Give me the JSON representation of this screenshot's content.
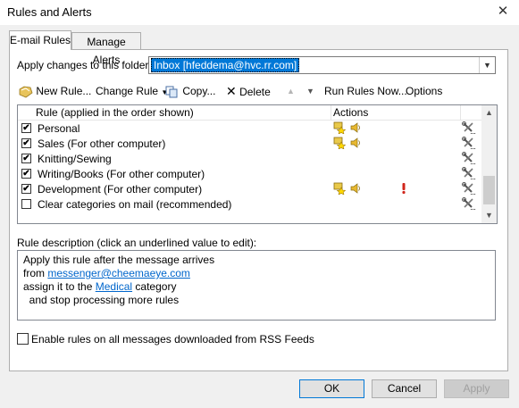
{
  "window": {
    "title": "Rules and Alerts",
    "close_glyph": "✕"
  },
  "tabs": [
    {
      "label": "E-mail Rules"
    },
    {
      "label": "Manage Alerts"
    }
  ],
  "folder": {
    "label": "Apply changes to this folder:",
    "value": "Inbox [hfeddema@hvc.rr.com]"
  },
  "toolbar": {
    "new_rule": "New Rule...",
    "change_rule": "Change Rule",
    "copy": "Copy...",
    "delete": "Delete",
    "run_rules": "Run Rules Now...",
    "options": "Options"
  },
  "rules_list": {
    "columns": {
      "rule": "Rule (applied in the order shown)",
      "actions": "Actions"
    },
    "rows": [
      {
        "name": "Personal",
        "checked": true,
        "icons": [
          "category-icon",
          "sound-icon"
        ]
      },
      {
        "name": "Sales  (For other computer)",
        "checked": true,
        "icons": [
          "category-icon",
          "sound-icon"
        ]
      },
      {
        "name": "Knitting/Sewing",
        "checked": true,
        "icons": []
      },
      {
        "name": "Writing/Books  (For other computer)",
        "checked": true,
        "icons": []
      },
      {
        "name": "Development  (For other computer)",
        "checked": true,
        "icons": [
          "category-icon",
          "sound-icon",
          "importance-icon"
        ]
      },
      {
        "name": "Clear categories on mail (recommended)",
        "checked": false,
        "icons": []
      }
    ],
    "checkmark": "✔"
  },
  "description": {
    "label": "Rule description (click an underlined value to edit):",
    "line1": "Apply this rule after the message arrives",
    "line2_prefix": "from ",
    "line2_link": "messenger@cheemaeye.com",
    "line3_prefix": "assign it to the ",
    "line3_link": "Medical",
    "line3_suffix": " category",
    "line4": "  and stop processing more rules"
  },
  "rss": {
    "label": "Enable rules on all messages downloaded from RSS Feeds",
    "checked": false
  },
  "buttons": {
    "ok": "OK",
    "cancel": "Cancel",
    "apply": "Apply"
  },
  "colors": {
    "selection": "#0078d7",
    "link": "#0066cc",
    "accent": "#0078d7"
  }
}
